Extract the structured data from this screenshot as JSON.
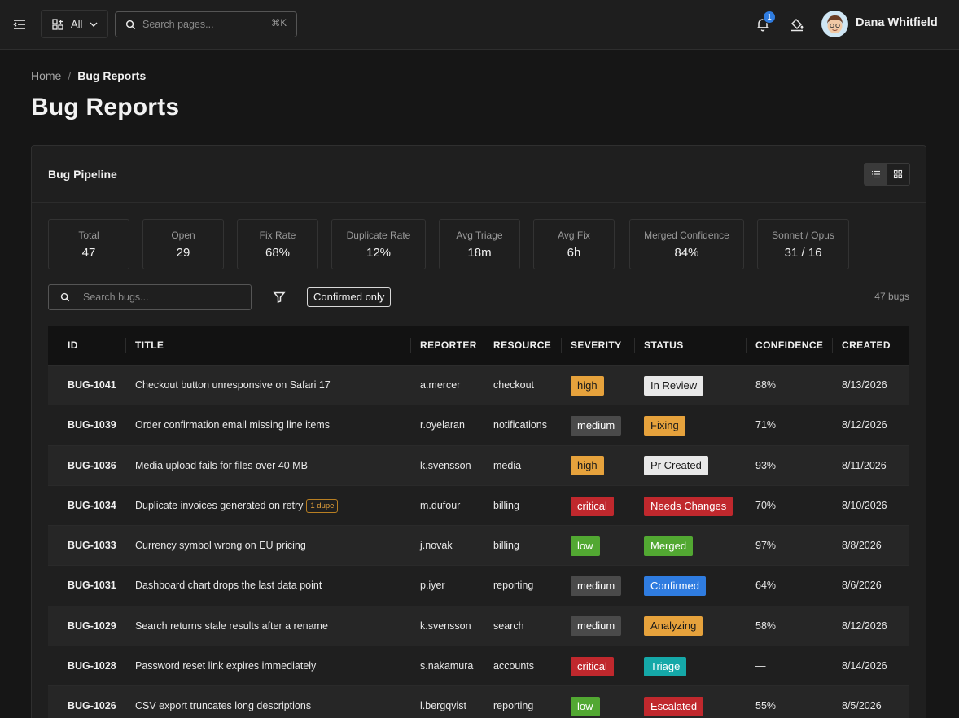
{
  "topbar": {
    "all_label": "All",
    "search_placeholder": "Search pages...",
    "search_shortcut": "⌘K",
    "notifications_count": "1",
    "user_name": "Dana Whitfield"
  },
  "breadcrumb": {
    "home": "Home",
    "separator": "/",
    "current": "Bug Reports"
  },
  "page_title": "Bug Reports",
  "card": {
    "title": "Bug Pipeline",
    "stats": [
      {
        "label": "Total",
        "value": "47"
      },
      {
        "label": "Open",
        "value": "29"
      },
      {
        "label": "Fix Rate",
        "value": "68%"
      },
      {
        "label": "Duplicate Rate",
        "value": "12%"
      },
      {
        "label": "Avg Triage",
        "value": "18m"
      },
      {
        "label": "Avg Fix",
        "value": "6h"
      },
      {
        "label": "Merged Confidence",
        "value": "84%"
      },
      {
        "label": "Sonnet / Opus",
        "value": "31 / 16"
      }
    ],
    "search_placeholder": "Search bugs...",
    "filter_chip": "Confirmed only",
    "bug_count": "47 bugs"
  },
  "table": {
    "columns": [
      "ID",
      "TITLE",
      "REPORTER",
      "RESOURCE",
      "SEVERITY",
      "STATUS",
      "CONFIDENCE",
      "CREATED"
    ],
    "rows": [
      {
        "id": "BUG-1041",
        "title": "Checkout button unresponsive on Safari 17",
        "dupe": "",
        "reporter": "a.mercer",
        "resource": "checkout",
        "severity": "high",
        "status": "In Review",
        "confidence": "88%",
        "created": "8/13/2026"
      },
      {
        "id": "BUG-1039",
        "title": "Order confirmation email missing line items",
        "dupe": "",
        "reporter": "r.oyelaran",
        "resource": "notifications",
        "severity": "medium",
        "status": "Fixing",
        "confidence": "71%",
        "created": "8/12/2026"
      },
      {
        "id": "BUG-1036",
        "title": "Media upload fails for files over 40 MB",
        "dupe": "",
        "reporter": "k.svensson",
        "resource": "media",
        "severity": "high",
        "status": "Pr Created",
        "confidence": "93%",
        "created": "8/11/2026"
      },
      {
        "id": "BUG-1034",
        "title": "Duplicate invoices generated on retry",
        "dupe": "1 dupe",
        "reporter": "m.dufour",
        "resource": "billing",
        "severity": "critical",
        "status": "Needs Changes",
        "confidence": "70%",
        "created": "8/10/2026"
      },
      {
        "id": "BUG-1033",
        "title": "Currency symbol wrong on EU pricing",
        "dupe": "",
        "reporter": "j.novak",
        "resource": "billing",
        "severity": "low",
        "status": "Merged",
        "confidence": "97%",
        "created": "8/8/2026"
      },
      {
        "id": "BUG-1031",
        "title": "Dashboard chart drops the last data point",
        "dupe": "",
        "reporter": "p.iyer",
        "resource": "reporting",
        "severity": "medium",
        "status": "Confirmed",
        "confidence": "64%",
        "created": "8/6/2026"
      },
      {
        "id": "BUG-1029",
        "title": "Search returns stale results after a rename",
        "dupe": "",
        "reporter": "k.svensson",
        "resource": "search",
        "severity": "medium",
        "status": "Analyzing",
        "confidence": "58%",
        "created": "8/12/2026"
      },
      {
        "id": "BUG-1028",
        "title": "Password reset link expires immediately",
        "dupe": "",
        "reporter": "s.nakamura",
        "resource": "accounts",
        "severity": "critical",
        "status": "Triage",
        "confidence": "—",
        "created": "8/14/2026"
      },
      {
        "id": "BUG-1026",
        "title": "CSV export truncates long descriptions",
        "dupe": "",
        "reporter": "l.bergqvist",
        "resource": "reporting",
        "severity": "low",
        "status": "Escalated",
        "confidence": "55%",
        "created": "8/5/2026"
      }
    ]
  },
  "colors": {
    "severity": {
      "high": "#e6a23c",
      "medium": "#4a4a4a",
      "critical": "#c0282d",
      "low": "#52a832"
    },
    "status": {
      "In Review": "#e8e8e8",
      "Fixing": "#e6a23c",
      "Pr Created": "#e8e8e8",
      "Needs Changes": "#c0282d",
      "Merged": "#52a832",
      "Confirmed": "#2f7ce0",
      "Analyzing": "#e6a23c",
      "Triage": "#15a8a8",
      "Escalated": "#c0282d"
    }
  }
}
